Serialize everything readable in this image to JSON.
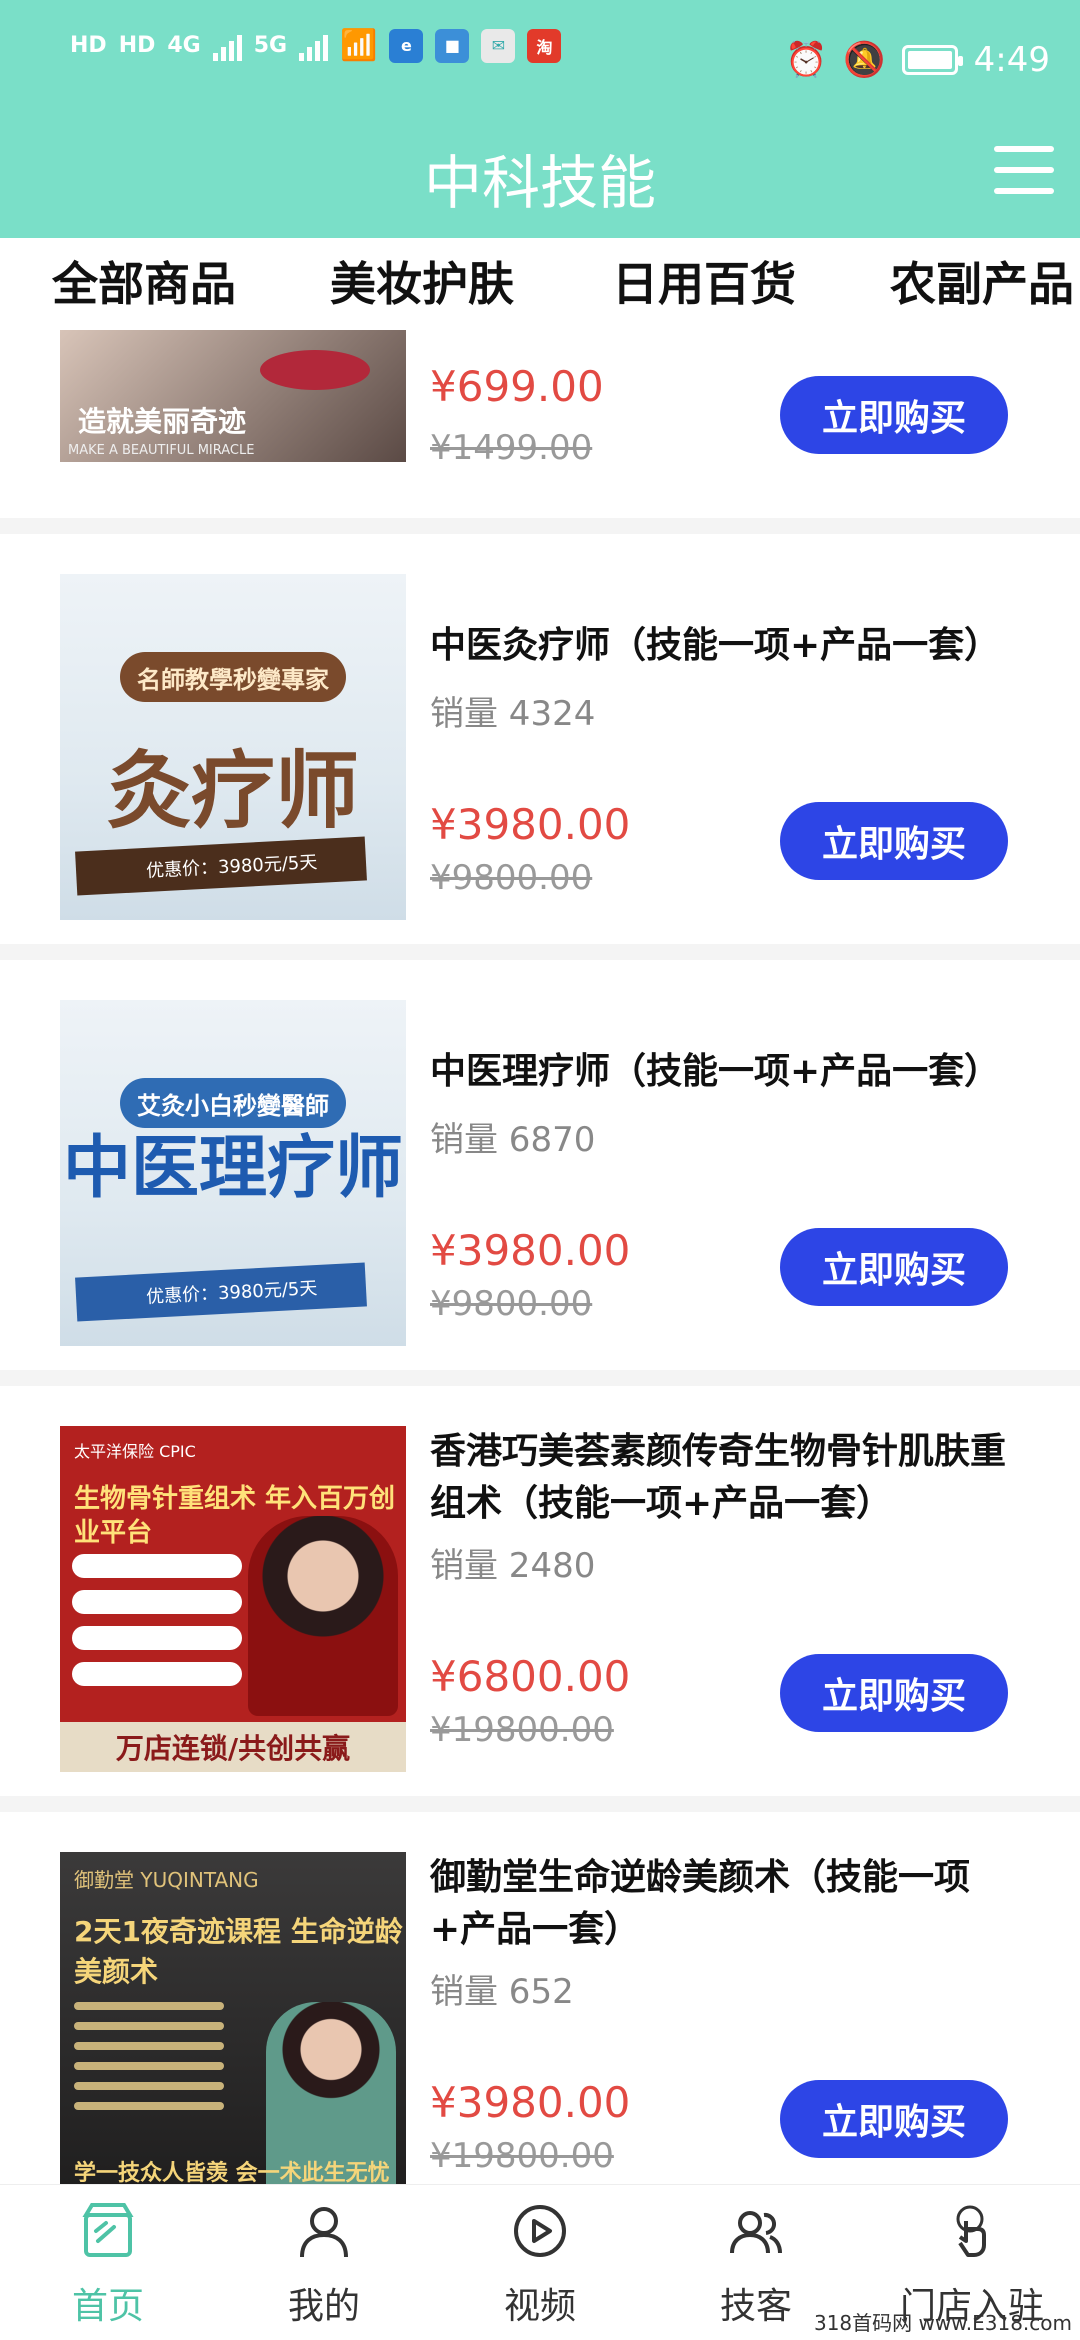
{
  "status_bar": {
    "left_labels": [
      "HD",
      "HD",
      "4G",
      "5G"
    ],
    "time": "4:49"
  },
  "header": {
    "title": "中科技能"
  },
  "tabs": [
    "全部商品",
    "美妆护肤",
    "日用百货",
    "农副产品"
  ],
  "products": [
    {
      "name": "",
      "sales": "",
      "price": "¥699.00",
      "old_price": "¥1499.00",
      "buy_label": "立即购买",
      "thumb_caption": "造就美丽奇迹",
      "thumb_subcaption": "MAKE A BEAUTIFUL MIRACLE"
    },
    {
      "name": "中医灸疗师（技能一项+产品一套）",
      "sales": "销量 4324",
      "price": "¥3980.00",
      "old_price": "¥9800.00",
      "buy_label": "立即购买",
      "thumb_banner": "名師教學秒變專家",
      "thumb_big": "灸疗师",
      "thumb_strip": "优惠价：3980元/5天"
    },
    {
      "name": "中医理疗师（技能一项+产品一套）",
      "sales": "销量 6870",
      "price": "¥3980.00",
      "old_price": "¥9800.00",
      "buy_label": "立即购买",
      "thumb_banner": "艾灸小白秒變醫師",
      "thumb_big": "中医理疗师",
      "thumb_strip": "优惠价：3980元/5天"
    },
    {
      "name": "香港巧美荟素颜传奇生物骨针肌肤重组术（技能一项+产品一套）",
      "sales": "销量 2480",
      "price": "¥6800.00",
      "old_price": "¥19800.00",
      "buy_label": "立即购买",
      "thumb_logo": "太平洋保险 CPIC",
      "thumb_headline": "生物骨针重组术 年入百万创业平台",
      "thumb_footer": "万店连锁/共创共赢"
    },
    {
      "name": "御勤堂生命逆龄美颜术（技能一项+产品一套）",
      "sales": "销量 652",
      "price": "¥3980.00",
      "old_price": "¥19800.00",
      "buy_label": "立即购买",
      "thumb_logo": "御勤堂 YUQINTANG",
      "thumb_headline": "2天1夜奇迹课程 生命逆龄美颜术",
      "thumb_footer": "学一技众人皆羡 会一术此生无忧"
    }
  ],
  "bottom_nav": [
    {
      "label": "首页",
      "icon": "store-icon",
      "active": true
    },
    {
      "label": "我的",
      "icon": "user-icon",
      "active": false
    },
    {
      "label": "视频",
      "icon": "video-icon",
      "active": false
    },
    {
      "label": "技客",
      "icon": "users-icon",
      "active": false
    },
    {
      "label": "门店入驻",
      "icon": "hand-tap-icon",
      "active": false
    }
  ],
  "watermark": "318首码网 www.E318.com",
  "colors": {
    "header_bg": "#7ADFC8",
    "buy_button": "#2D45E6",
    "price_red": "#E24A43",
    "nav_active": "#4EC3A6"
  }
}
